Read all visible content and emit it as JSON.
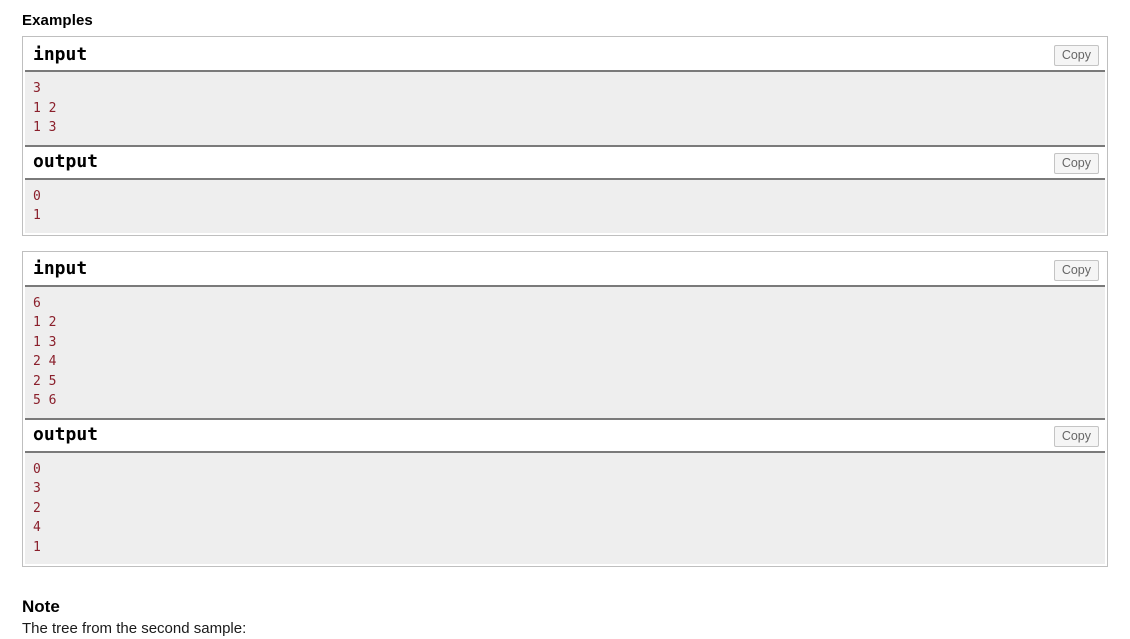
{
  "page": {
    "examples_heading": "Examples",
    "note_heading": "Note",
    "note_text": "The tree from the second sample:"
  },
  "ui": {
    "copy_label": "Copy",
    "input_label": "input",
    "output_label": "output",
    "accent_color": "#8a1f2b",
    "data_background": "#eeeeee",
    "border_color": "#7a7a7a",
    "outer_border_color": "#bfbfbf"
  },
  "samples": [
    {
      "input_label": "input",
      "input_lines": [
        "3",
        "1 2",
        "1 3"
      ],
      "output_label": "output",
      "output_lines": [
        "0",
        "1"
      ]
    },
    {
      "input_label": "input",
      "input_lines": [
        "6",
        "1 2",
        "1 3",
        "2 4",
        "2 5",
        "5 6"
      ],
      "output_label": "output",
      "output_lines": [
        "0",
        "3",
        "2",
        "4",
        "1"
      ]
    }
  ]
}
